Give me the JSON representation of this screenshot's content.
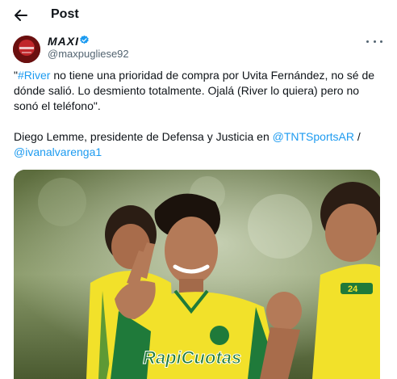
{
  "header": {
    "title": "Post",
    "back_icon": "arrow-left-icon"
  },
  "author": {
    "display_name": "MAXI",
    "handle": "@maxpugliese92",
    "verified": true,
    "avatar_color": "#b22222"
  },
  "tweet": {
    "line1": {
      "open_quote": "\"",
      "hashtag": "#River",
      "rest": " no tiene una prioridad de compra por Uvita Fernández, no sé de dónde salió. Lo desmiento totalmente. Ojalá (River lo quiera) pero no sonó el teléfono\"."
    },
    "line2": {
      "prefix": "Diego Lemme, presidente de Defensa y Justicia en ",
      "mention1": "@TNTSportsAR",
      "separator": " / ",
      "mention2": "@ivanalvarenga1"
    }
  },
  "media": {
    "sponsor_text": "RapiCuotas",
    "number": "24"
  },
  "colors": {
    "link": "#1d9bf0",
    "secondary_text": "#536471",
    "jersey_yellow": "#f2e12a",
    "jersey_green": "#1f7a3a"
  }
}
